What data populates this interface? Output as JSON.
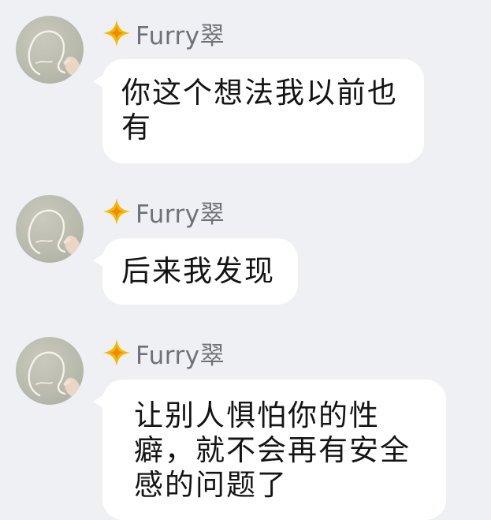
{
  "colors": {
    "background": "#eef0f3",
    "bubble": "#ffffff",
    "text": "#141414",
    "name": "#6f7178",
    "badge": "#f5b800"
  },
  "messages": [
    {
      "sender": "Furry翠",
      "badge_icon": "orange-diamond-star-icon",
      "avatar_icon": "sketch-figure-avatar",
      "text": "你这个想法我以前也有"
    },
    {
      "sender": "Furry翠",
      "badge_icon": "orange-diamond-star-icon",
      "avatar_icon": "sketch-figure-avatar",
      "text": "后来我发现"
    },
    {
      "sender": "Furry翠",
      "badge_icon": "orange-diamond-star-icon",
      "avatar_icon": "sketch-figure-avatar",
      "text": "让别人惧怕你的性癖，就不会再有安全感的问题了"
    }
  ]
}
